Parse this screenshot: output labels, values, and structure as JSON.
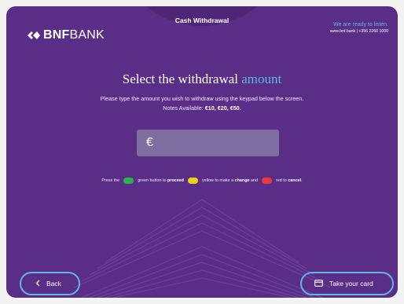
{
  "header": {
    "brand_bold": "BNF",
    "brand_light": "BANK",
    "title": "Cash Withdrawal",
    "tagline": "We are ready to listen.",
    "contact": "www.bnf.bank | +356 2260 1000"
  },
  "main": {
    "heading_prefix": "Select the withdrawal ",
    "heading_accent": "amount",
    "instruction_line": "Please type the amount you wish to withdraw using the keypad below the screen.",
    "notes_label": "Notes Available: ",
    "notes_values": "€10, €20, €50.",
    "amount_symbol": "€",
    "amount_value": ""
  },
  "legend": {
    "t1": "Press the",
    "t2": "green button to",
    "proceed": "proceed",
    "t3": "yellow to make a",
    "change": "change",
    "t4": "and",
    "t5": "red to",
    "cancel": "cancel",
    "t6": "."
  },
  "buttons": {
    "back_label": "Back",
    "card_label": "Take your card"
  },
  "colors": {
    "background": "#5a2e86",
    "accent": "#5fb7e8",
    "green": "#2db24d",
    "yellow": "#e9d21a",
    "red": "#e8393d",
    "input_bg": "#806da0"
  },
  "icons": {
    "logo": "bnf-chevron-logo",
    "back": "chevron-left-icon",
    "card": "card-icon"
  }
}
